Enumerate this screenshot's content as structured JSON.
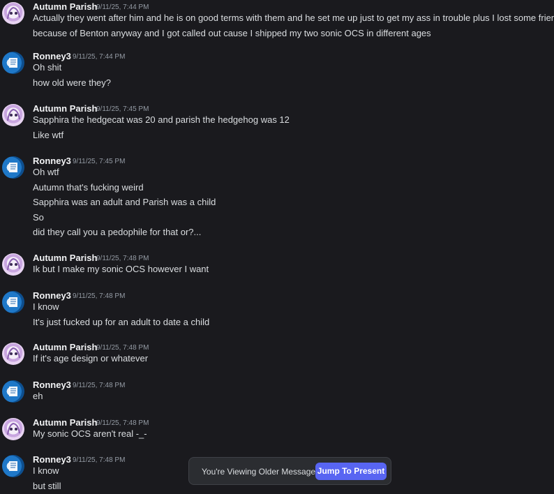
{
  "messages": [
    {
      "author": "Autumn Parish",
      "timestamp": "9/11/25, 7:44 PM",
      "avatar": "autumn-avatar",
      "lines": [
        "Actually they went after him and he is on good terms with them and he set me up just to get my ass in trouble plus I lost some friends",
        "because of Benton anyway and I got called out cause I shipped my two sonic OCS in different ages"
      ]
    },
    {
      "author": "Ronney3",
      "timestamp": "9/11/25, 7:44 PM",
      "avatar": "ronney-avatar",
      "lines": [
        "Oh shit",
        "how old were they?"
      ]
    },
    {
      "author": "Autumn Parish",
      "timestamp": "9/11/25, 7:45 PM",
      "avatar": "autumn-avatar",
      "lines": [
        "Sapphira the hedgecat was 20 and parish the hedgehog was 12",
        "Like wtf"
      ]
    },
    {
      "author": "Ronney3",
      "timestamp": "9/11/25, 7:45 PM",
      "avatar": "ronney-avatar",
      "lines": [
        "Oh wtf",
        "Autumn that's fucking weird",
        "Sapphira was an adult and Parish was a child",
        "So",
        "did they call you a pedophile for that or?..."
      ]
    },
    {
      "author": "Autumn Parish",
      "timestamp": "9/11/25, 7:48 PM",
      "avatar": "autumn-avatar",
      "lines": [
        "Ik but I make my sonic OCS however I want"
      ]
    },
    {
      "author": "Ronney3",
      "timestamp": "9/11/25, 7:48 PM",
      "avatar": "ronney-avatar",
      "lines": [
        "I know",
        "It's just fucked up for an adult to date a child"
      ]
    },
    {
      "author": "Autumn Parish",
      "timestamp": "9/11/25, 7:48 PM",
      "avatar": "autumn-avatar",
      "lines": [
        "If it's age design or whatever"
      ]
    },
    {
      "author": "Ronney3",
      "timestamp": "9/11/25, 7:48 PM",
      "avatar": "ronney-avatar",
      "lines": [
        "eh"
      ]
    },
    {
      "author": "Autumn Parish",
      "timestamp": "9/11/25, 7:48 PM",
      "avatar": "autumn-avatar",
      "lines": [
        "My sonic OCS aren't real -_-"
      ]
    },
    {
      "author": "Ronney3",
      "timestamp": "9/11/25, 7:48 PM",
      "avatar": "ronney-avatar",
      "lines": [
        "I know",
        "but still"
      ]
    }
  ],
  "banner": {
    "text": "You're Viewing Older Messages",
    "jump_label": "Jump To Present"
  },
  "colors": {
    "background": "#1a1a1e",
    "username": "#f2f3f5",
    "timestamp": "#949ba4",
    "message_text": "#dbdee1",
    "accent": "#5865f2"
  }
}
